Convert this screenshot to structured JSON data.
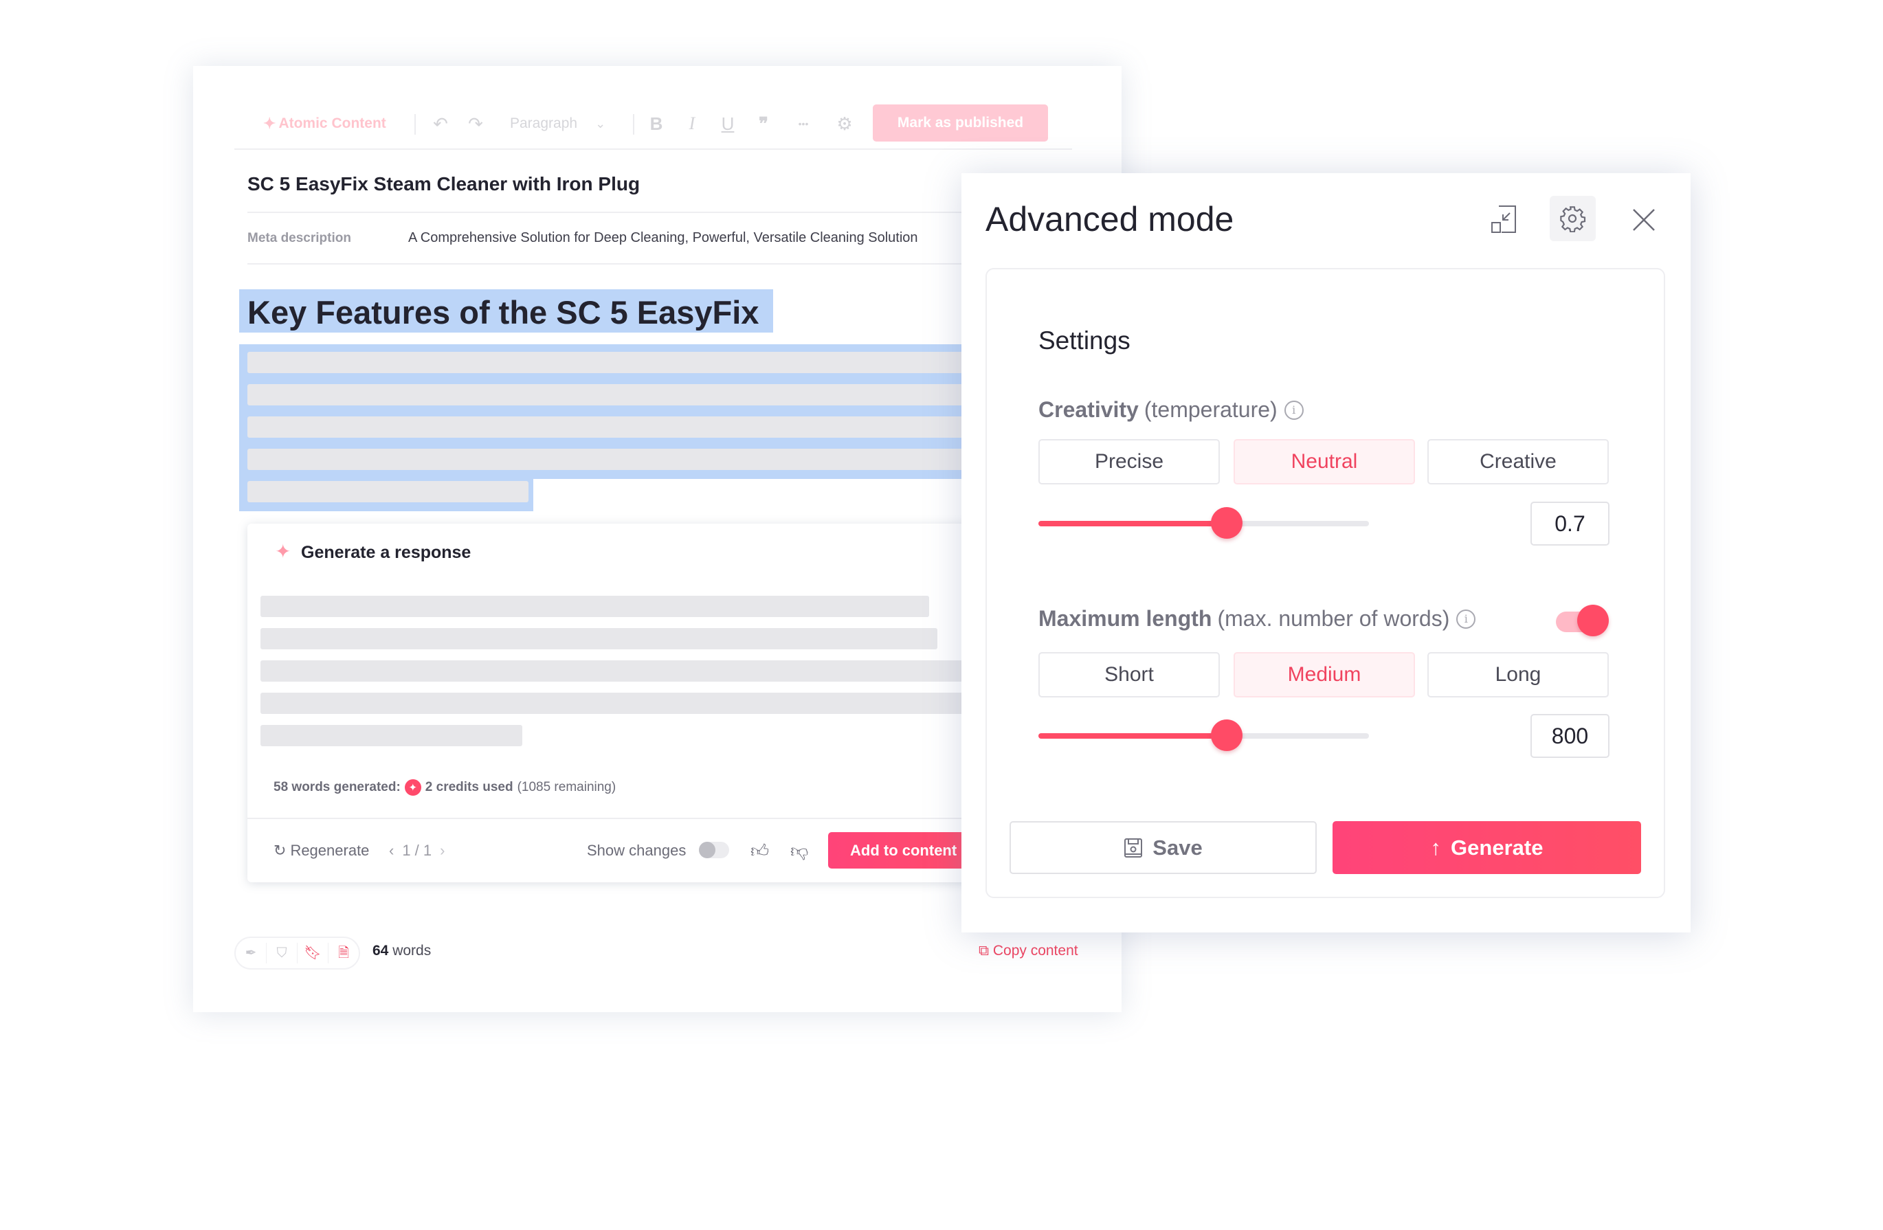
{
  "editor": {
    "toolbar": {
      "atomic_icon": "sparkle-icon",
      "atomic_label": "Atomic Content",
      "undo_icon": "undo-icon",
      "redo_icon": "redo-icon",
      "block_type": "Paragraph",
      "bold": "B",
      "italic": "I",
      "underline": "U",
      "quote": "❞",
      "more": "•••",
      "settings_icon": "gear-icon",
      "publish_label": "Mark as published"
    },
    "title": "SC 5 EasyFix Steam Cleaner with Iron Plug",
    "meta_label": "Meta description",
    "meta_value": "A Comprehensive Solution for Deep Cleaning, Powerful, Versatile Cleaning Solution",
    "heading": "Key Features of the SC 5 EasyFix",
    "generate_panel": {
      "title": "Generate a response",
      "credits_prefix": "58 words generated:",
      "credits_used": "2 credits used",
      "credits_remaining": "(1085 remaining)",
      "regenerate_label": "Regenerate",
      "pager": "1 / 1",
      "show_changes_label": "Show changes",
      "show_changes_on": false,
      "add_label": "Add to content"
    },
    "footer": {
      "icons": [
        "pen-nib-icon",
        "shield-check-icon",
        "bookmark-icon",
        "document-edit-icon"
      ],
      "word_count": "64",
      "word_suffix": "words",
      "copy_label": "Copy content"
    }
  },
  "modal": {
    "title": "Advanced mode",
    "collapse_icon": "collapse-icon",
    "settings_icon": "gear-icon",
    "close_icon": "close-icon",
    "settings_title": "Settings",
    "creativity": {
      "label": "Creativity",
      "sublabel": "(temperature)",
      "options": [
        "Precise",
        "Neutral",
        "Creative"
      ],
      "selected": "Neutral",
      "value": "0.7",
      "slider_fraction": 0.57
    },
    "max_length": {
      "label": "Maximum length",
      "sublabel": "(max. number of words)",
      "enabled": true,
      "options": [
        "Short",
        "Medium",
        "Long"
      ],
      "selected": "Medium",
      "value": "800",
      "slider_fraction": 0.57
    },
    "save_label": "Save",
    "generate_label": "Generate"
  },
  "colors": {
    "accent": "#ff4b66",
    "accent_light": "#fff3f5",
    "selection": "#bcd5f8"
  }
}
